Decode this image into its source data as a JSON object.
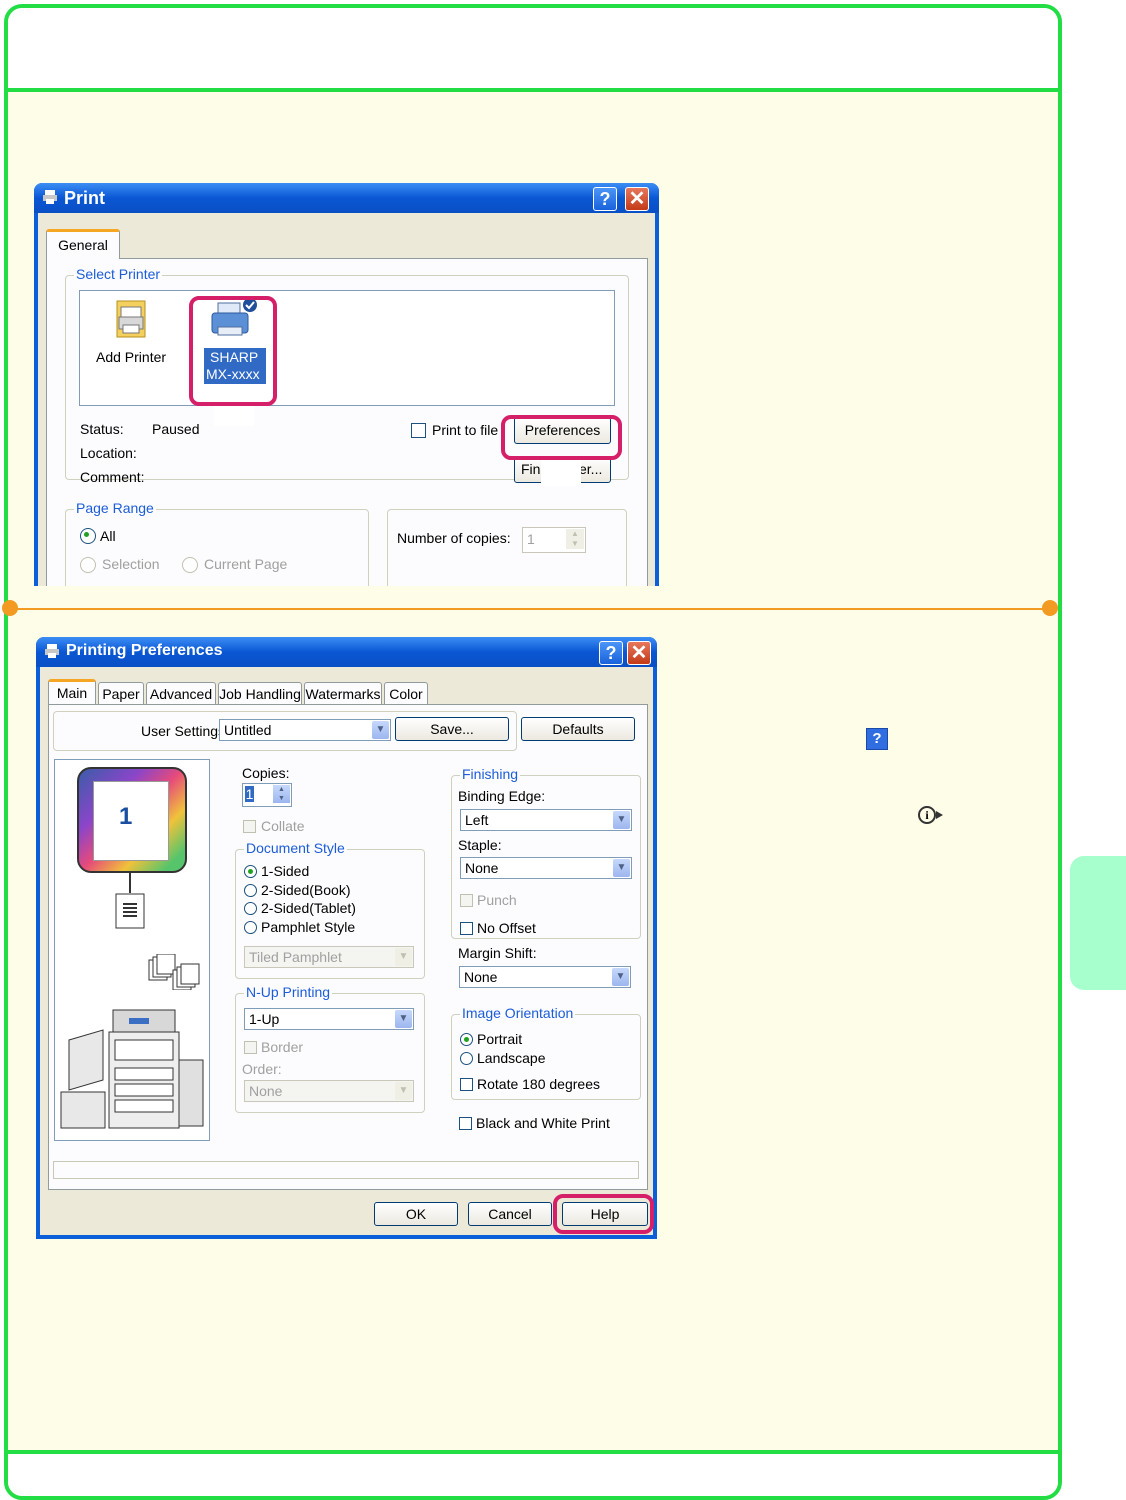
{
  "print_dialog": {
    "title": "Print",
    "tab_general": "General",
    "select_printer_group": "Select Printer",
    "add_printer_label": "Add Printer",
    "selected_printer_line1": "SHARP",
    "selected_printer_line2": "MX-xxxx",
    "status_label": "Status:",
    "status_value": "Paused",
    "location_label": "Location:",
    "comment_label": "Comment:",
    "print_to_file_label": "Print to file",
    "preferences_button": "Preferences",
    "find_printer_left": "Find",
    "find_printer_right": "er...",
    "page_range_group": "Page Range",
    "range_all": "All",
    "range_selection": "Selection",
    "range_current": "Current Page",
    "copies_label": "Number of copies:",
    "copies_value": "1"
  },
  "prefs_dialog": {
    "title": "Printing Preferences",
    "tabs": [
      "Main",
      "Paper",
      "Advanced",
      "Job Handling",
      "Watermarks",
      "Color"
    ],
    "user_settings_label": "User Settings:",
    "user_settings_value": "Untitled",
    "save_button": "Save...",
    "defaults_button": "Defaults",
    "preview_page_number": "1",
    "copies_label": "Copies:",
    "copies_value": "1",
    "collate_label": "Collate",
    "document_style_group": "Document Style",
    "doc_style_options": [
      "1-Sided",
      "2-Sided(Book)",
      "2-Sided(Tablet)",
      "Pamphlet Style"
    ],
    "pamphlet_value": "Tiled Pamphlet",
    "nup_group": "N-Up Printing",
    "nup_value": "1-Up",
    "border_label": "Border",
    "order_label": "Order:",
    "order_value": "None",
    "finishing_group": "Finishing",
    "binding_edge_label": "Binding Edge:",
    "binding_edge_value": "Left",
    "staple_label": "Staple:",
    "staple_value": "None",
    "punch_label": "Punch",
    "no_offset_label": "No Offset",
    "margin_shift_label": "Margin Shift:",
    "margin_shift_value": "None",
    "orientation_group": "Image Orientation",
    "portrait_label": "Portrait",
    "landscape_label": "Landscape",
    "rotate_label": "Rotate 180 degrees",
    "bw_label": "Black and White Print",
    "ok_button": "OK",
    "cancel_button": "Cancel",
    "help_button": "Help"
  },
  "side_icons": {
    "help": "?",
    "info": "i"
  },
  "colors": {
    "frame": "#22dd44",
    "accent": "#f29a22",
    "highlight": "#d61f69",
    "side_tab": "#a6ffcc",
    "selection": "#316ac5"
  }
}
